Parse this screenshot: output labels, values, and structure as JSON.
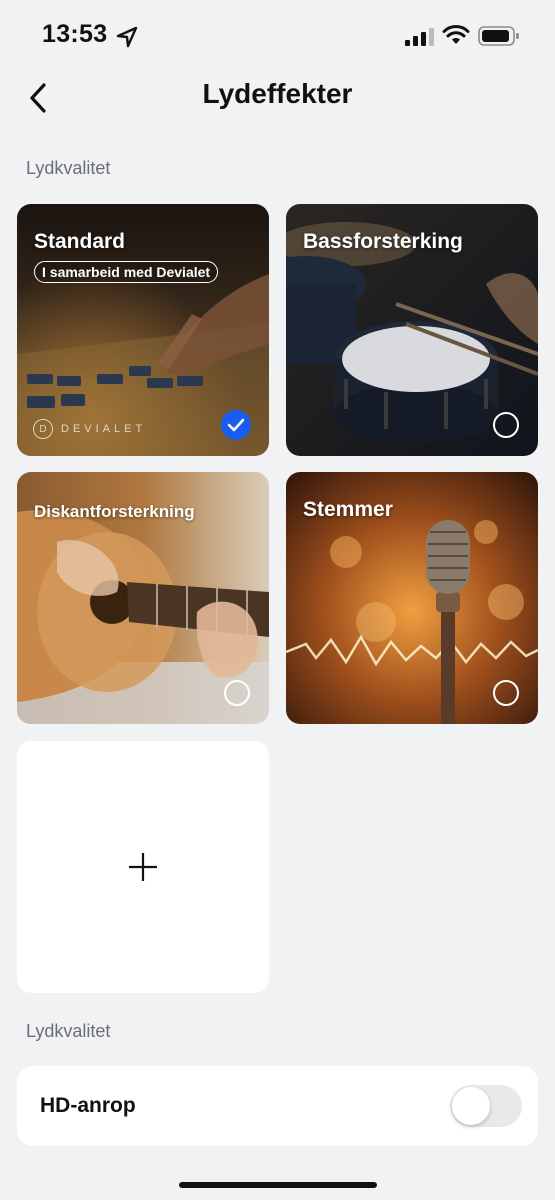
{
  "status_bar": {
    "time": "13:53",
    "icons": [
      "location-icon",
      "signal-icon",
      "wifi-icon",
      "battery-icon"
    ]
  },
  "header": {
    "title": "Lydeffekter",
    "back_icon": "chevron-left-icon"
  },
  "section_quality": {
    "label": "Lydkvalitet"
  },
  "effects": [
    {
      "title": "Standard",
      "badge": "I samarbeid med Devialet",
      "brand": "DEVIALET",
      "brand_mark": "D",
      "selected": true
    },
    {
      "title": "Bassforsterking",
      "selected": false
    },
    {
      "title": "Diskantforsterkning",
      "selected": false
    },
    {
      "title": "Stemmer",
      "selected": false
    }
  ],
  "add_card": {
    "icon": "plus-icon"
  },
  "section_calls": {
    "label": "Lydkvalitet"
  },
  "hd_call": {
    "label": "HD-anrop",
    "enabled": false
  },
  "colors": {
    "background": "#f1f2f4",
    "accent": "#1a5cf0",
    "card": "#ffffff"
  }
}
